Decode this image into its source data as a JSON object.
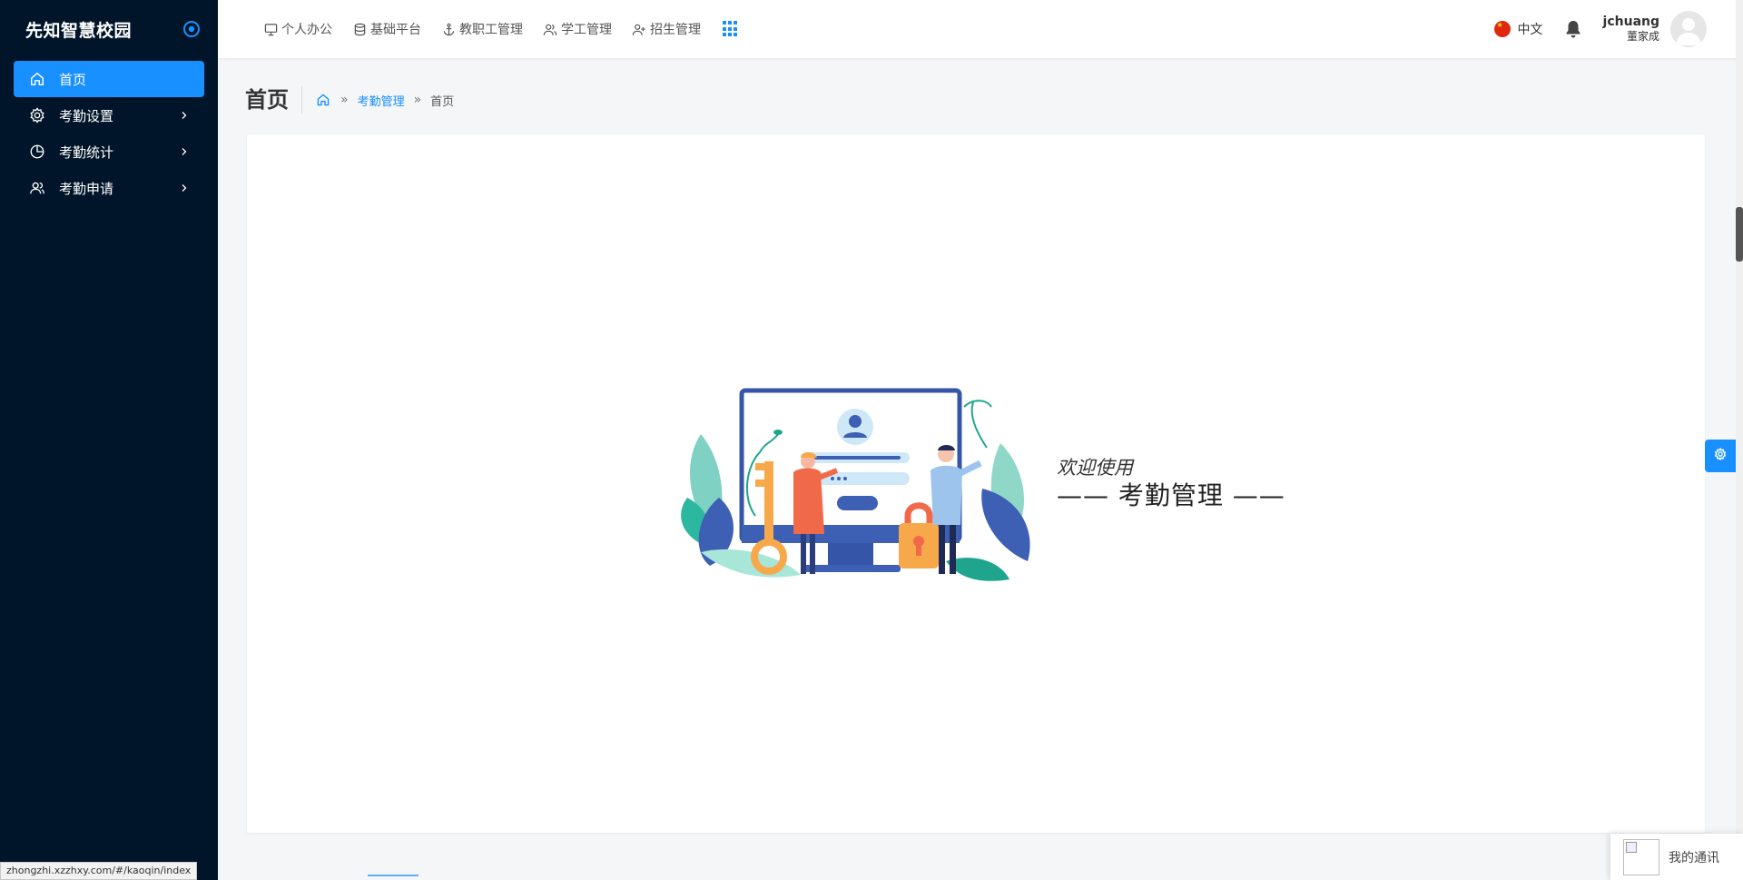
{
  "sidebar": {
    "brand": "先知智慧校园",
    "items": [
      {
        "label": "首页",
        "icon": "home-icon",
        "active": true
      },
      {
        "label": "考勤设置",
        "icon": "gear-icon",
        "active": false
      },
      {
        "label": "考勤统计",
        "icon": "pie-chart-icon",
        "active": false
      },
      {
        "label": "考勤申请",
        "icon": "users-icon",
        "active": false
      }
    ]
  },
  "header": {
    "nav": [
      {
        "label": "个人办公",
        "icon": "monitor-icon"
      },
      {
        "label": "基础平台",
        "icon": "database-icon"
      },
      {
        "label": "教职工管理",
        "icon": "anchor-icon"
      },
      {
        "label": "学工管理",
        "icon": "users-icon"
      },
      {
        "label": "招生管理",
        "icon": "user-add-icon"
      }
    ],
    "language": "中文",
    "user": {
      "name": "jchuang",
      "org": "董家成"
    }
  },
  "page": {
    "title": "首页",
    "breadcrumb": {
      "link": "考勤管理",
      "current": "首页",
      "separator": "»"
    }
  },
  "content": {
    "welcome_sub": "欢迎使用",
    "welcome_main": "—— 考勤管理 ——"
  },
  "status_url": "zhongzhi.xzzhxy.com/#/kaoqin/index",
  "contacts": {
    "label": "我的通讯"
  },
  "colors": {
    "sidebar_bg": "#001529",
    "accent": "#1890ff",
    "page_bg": "#f5f6f8"
  }
}
